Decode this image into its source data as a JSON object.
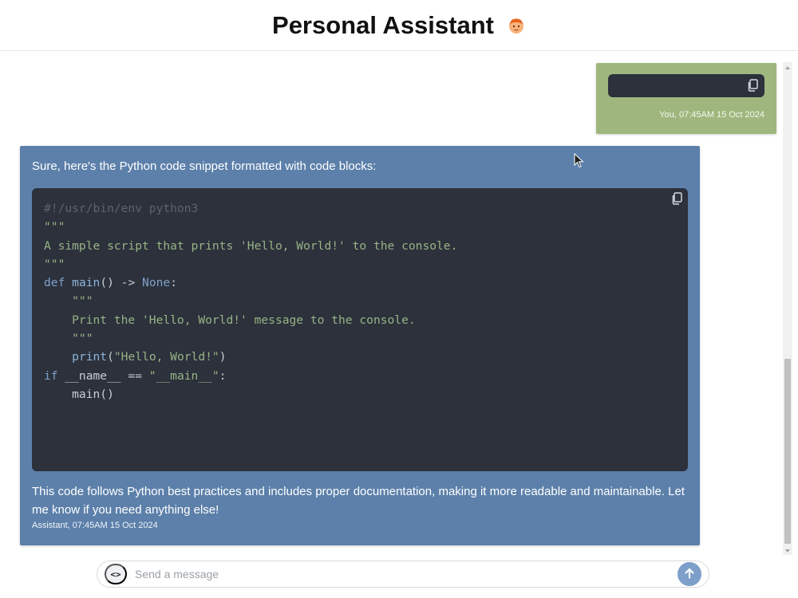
{
  "header": {
    "title": "Personal Assistant",
    "avatar_icon": "child-face-icon"
  },
  "messages": {
    "user": {
      "code": "",
      "timestamp": "You, 07:45AM 15 Oct 2024",
      "bubble_color": "#9fb77e"
    },
    "assistant": {
      "intro": "Sure, here's the Python code snippet formatted with code blocks:",
      "code_lines": [
        "#!/usr/bin/env python3",
        "",
        "\"\"\"",
        "A simple script that prints 'Hello, World!' to the console.",
        "\"\"\"",
        "",
        "def main() -> None:",
        "    \"\"\"",
        "    Print the 'Hello, World!' message to the console.",
        "    \"\"\"",
        "    print(\"Hello, World!\")",
        "",
        "if __name__ == \"__main__\":",
        "    main()"
      ],
      "outro": "This code follows Python best practices and includes proper documentation, making it more readable and maintainable. Let me know if you need anything else!",
      "timestamp": "Assistant, 07:45AM 15 Oct 2024",
      "bubble_color": "#5c80aa"
    }
  },
  "composer": {
    "placeholder": "Send a message",
    "value": "",
    "code_toggle_label": "<>",
    "send_icon": "arrow-up-icon"
  },
  "colors": {
    "code_background": "#2c313c",
    "send_button": "#7d9fca"
  }
}
